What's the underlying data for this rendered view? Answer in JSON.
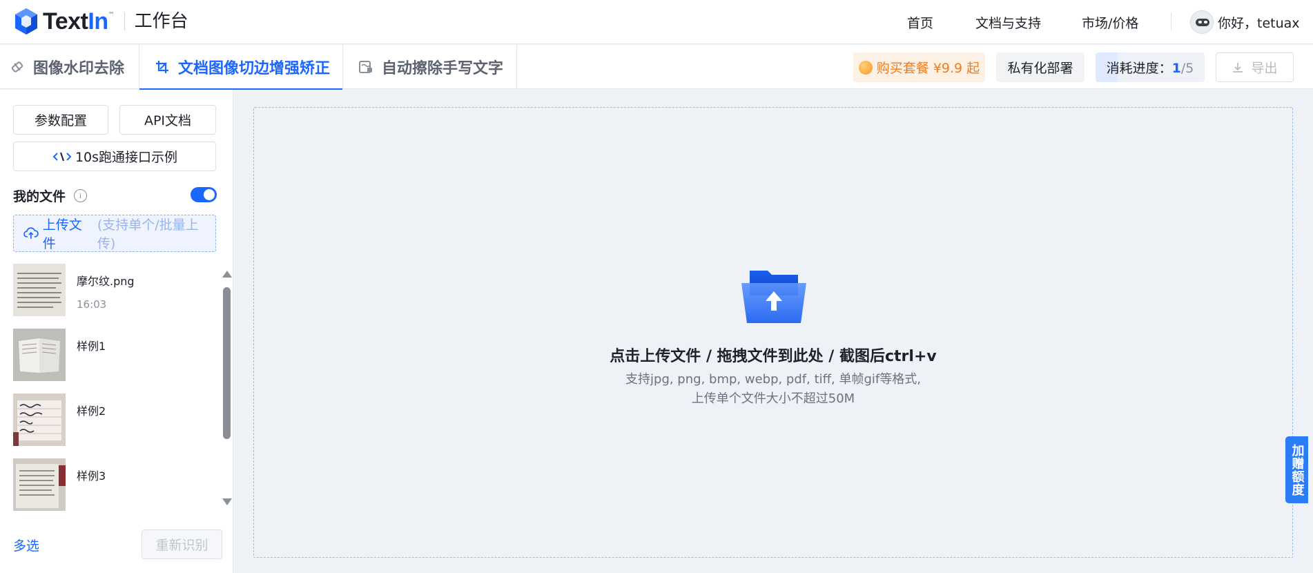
{
  "header": {
    "logo_text_a": "Text",
    "logo_text_b": "In",
    "logo_tm": "™",
    "workbench": "工作台",
    "nav": [
      "首页",
      "文档与支持",
      "市场/价格"
    ],
    "greeting": "你好，tetuax"
  },
  "toolbar": {
    "tabs": [
      {
        "label": "图像水印去除",
        "icon": "eraser-icon",
        "active": false
      },
      {
        "label": "文档图像切边增强矫正",
        "icon": "crop-icon",
        "active": true
      },
      {
        "label": "自动擦除手写文字",
        "icon": "handwriting-eraser-icon",
        "active": false
      }
    ],
    "promo": "购买套餐 ¥9.9 起",
    "private_deploy": "私有化部署",
    "progress_label": "消耗进度：",
    "progress_used": "1",
    "progress_sep": "/",
    "progress_total": "5",
    "progress_fraction": 0.2,
    "export": "导出"
  },
  "sidebar": {
    "param_config": "参数配置",
    "api_docs": "API文档",
    "demo": "10s跑通接口示例",
    "my_files": "我的文件",
    "info_glyph": "i",
    "toggle_on": true,
    "upload": "上传文件",
    "upload_hint": "(支持单个/批量上传)",
    "files": [
      {
        "name": "摩尔纹.png",
        "time": "16:03"
      },
      {
        "name": "样例1",
        "time": ""
      },
      {
        "name": "样例2",
        "time": ""
      },
      {
        "name": "样例3",
        "time": ""
      }
    ],
    "multi_select": "多选",
    "reidentify": "重新识别"
  },
  "dropzone": {
    "title": "点击上传文件 / 拖拽文件到此处 / 截图后ctrl+v",
    "desc_line1": "支持jpg, png, bmp, webp, pdf, tiff, 单帧gif等格式,",
    "desc_line2": "上传单个文件大小不超过50M"
  },
  "side_tag": "加赠额度",
  "colors": {
    "accent": "#1a66ff",
    "promo": "#f07c1b",
    "promo_bg": "#fdf1e6"
  }
}
